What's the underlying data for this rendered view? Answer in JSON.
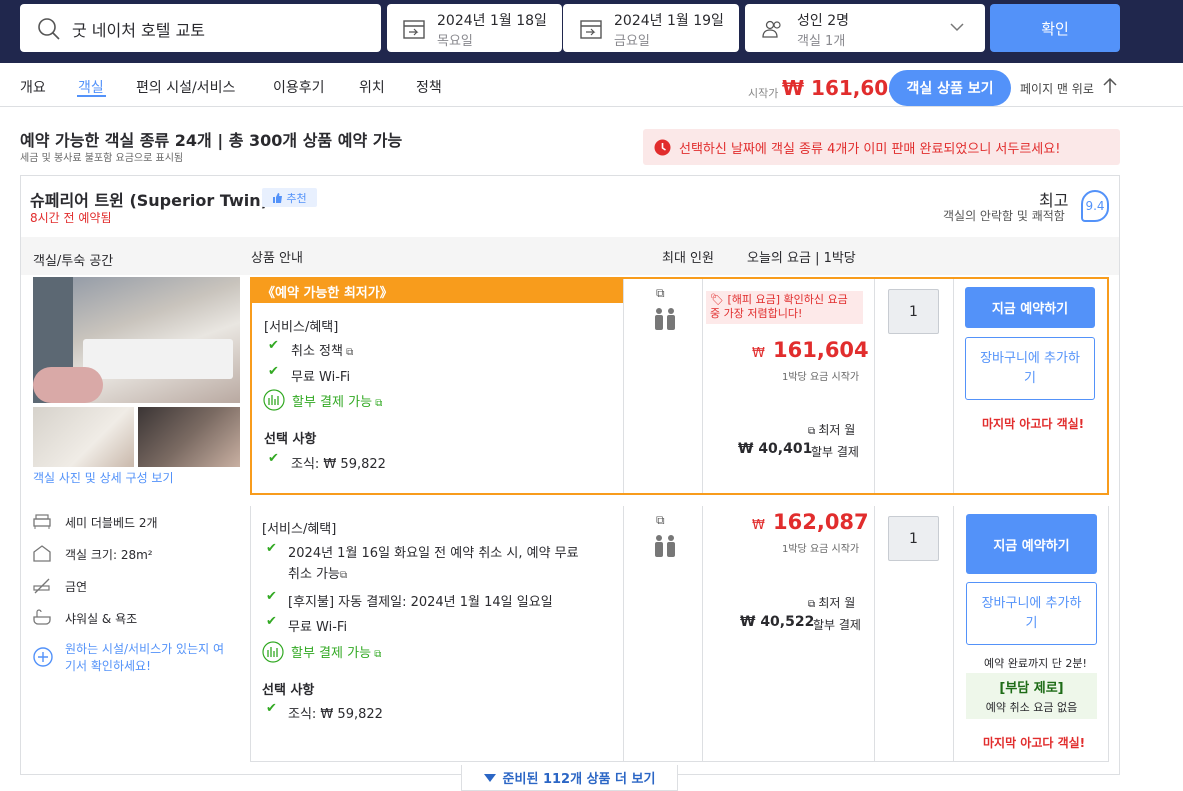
{
  "search": {
    "hotel": "굿 네이처 호텔 교토",
    "checkin_date": "2024년 1월 18일",
    "checkin_day": "목요일",
    "checkout_date": "2024년 1월 19일",
    "checkout_day": "금요일",
    "guests": "성인 2명",
    "rooms": "객실 1개",
    "confirm": "확인"
  },
  "tabs": [
    "개요",
    "객실",
    "편의 시설/서비스",
    "이용후기",
    "위치",
    "정책"
  ],
  "header_right": {
    "from_label": "시작가",
    "price": "₩ 161,604",
    "view_rooms": "객실 상품 보기",
    "back_to_top": "페이지 맨 위로"
  },
  "summary": {
    "title": "예약 가능한 객실 종류 24개 | 총 300개 상품 예약 가능",
    "note": "세금 및 봉사료 불포함 요금으로 표시됨",
    "urgency": "선택하신 날짜에 객실 종류 4개가 이미 판매 완료되었으니 서두르세요!"
  },
  "room": {
    "name": "슈페리어 트윈 (Superior Twin)",
    "recommend": "추천",
    "booked_ago": "8시간 전 예약됨",
    "rating_label": "최고",
    "rating_desc": "객실의 안락함 및 쾌적함",
    "rating": "9.4",
    "col_room": "객실/투숙 공간",
    "col_offer": "상품 안내",
    "col_capacity": "최대 인원",
    "col_price": "오늘의 요금 | 1박당",
    "photos_link": "객실 사진 및 상세 구성 보기",
    "features": [
      "세미 더블베드 2개",
      "객실 크기: 28m²",
      "금연",
      "샤워실 & 욕조"
    ],
    "more_facilities": "원하는 시설/서비스가 있는지 여기서 확인하세요!"
  },
  "offer1": {
    "badge": "《예약 가능한 최저가》",
    "benefits_title": "[서비스/혜택]",
    "benefits": [
      "취소 정책",
      "무료 Wi-Fi"
    ],
    "installment": "할부 결제 가능",
    "options_title": "선택 사항",
    "breakfast": "조식: ₩ 59,822",
    "happy_tag": "[해피 요금] 확인하신 요금 중 가장 저렴합니다!",
    "old_price": "₩",
    "price": "161,604",
    "price_note": "1박당 요금 시작가",
    "monthly_label": "최저 월",
    "monthly": "₩ 40,401",
    "monthly_suffix": "할부 결제",
    "qty": "1",
    "book": "지금 예약하기",
    "cart": "장바구니에 추가하기",
    "last_room": "마지막 아고다 객실!"
  },
  "offer2": {
    "benefits_title": "[서비스/혜택]",
    "cancel": "2024년 1월 16일 화요일 전 예약 취소 시, 예약 무료 취소 가능",
    "paylater": "[후지불] 자동 결제일: 2024년 1월 14일 일요일",
    "wifi": "무료 Wi-Fi",
    "installment": "할부 결제 가능",
    "options_title": "선택 사항",
    "breakfast": "조식: ₩ 59,822",
    "old_price": "₩",
    "price": "162,087",
    "price_note": "1박당 요금 시작가",
    "monthly_label": "최저 월",
    "monthly": "₩ 40,522",
    "monthly_suffix": "할부 결제",
    "qty": "1",
    "book": "지금 예약하기",
    "cart": "장바구니에 추가하기",
    "timer": "예약 완료까지 단 2분!",
    "zero_title": "[부담 제로]",
    "zero_desc": "예약 취소 요금 없음",
    "last_room": "마지막 아고다 객실!"
  },
  "more": "준비된 112개 상품 더 보기",
  "colors": {
    "brand": "#5392f9",
    "navy": "#20274d",
    "red": "#e12d2d",
    "orange": "#f89c1c",
    "green": "#32a923"
  }
}
